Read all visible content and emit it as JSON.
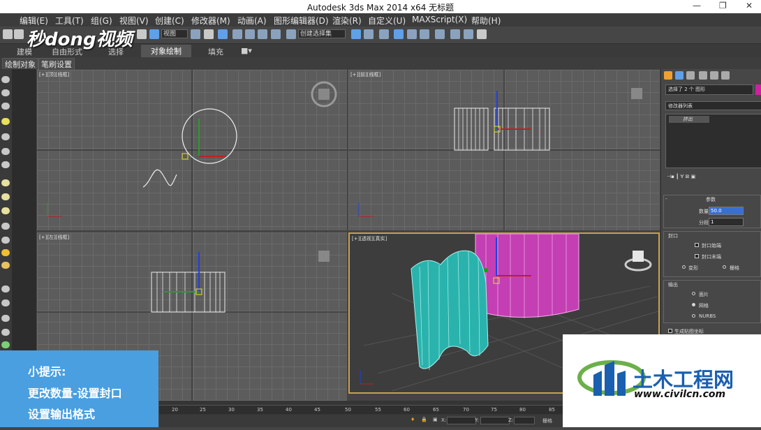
{
  "titlebar": {
    "title": "Autodesk 3ds Max  2014 x64     无标题",
    "controls": [
      "—",
      "❐",
      "✕"
    ]
  },
  "menu": {
    "items": [
      "编辑(E)",
      "工具(T)",
      "组(G)",
      "视图(V)",
      "创建(C)",
      "修改器(M)",
      "动画(A)",
      "图形编辑器(D)",
      "渲染(R)",
      "自定义(U)",
      "MAXScript(X)",
      "帮助(H)"
    ]
  },
  "toolbar": {
    "view_select": "视图",
    "named_sel": "创建选择集"
  },
  "ribbon": {
    "tabs": [
      "建模",
      "自由形式",
      "选择",
      "对象绘制",
      "填充"
    ],
    "active": "对象绘制",
    "subtabs": [
      "绘制对象",
      "笔刷设置"
    ]
  },
  "watermark": "秒dong视频",
  "viewports": {
    "top": "[+][顶][线框]",
    "front": "[+][前][线框]",
    "left": "[+][左][线框]",
    "perspective": "[+][透视][真实]"
  },
  "command_panel": {
    "selection_info": "选择了 2 个 图形",
    "modifier_list": "修改器列表",
    "stack_item": "挤出",
    "params_title": "参数",
    "amount_label": "数量:",
    "amount_value": "50.0",
    "segments_label": "分段:",
    "segments_value": "1",
    "capping_title": "封口",
    "cap_start": "封口始端",
    "cap_end": "封口末端",
    "morph": "变形",
    "grid": "栅格",
    "output_title": "输出",
    "patch": "面片",
    "mesh": "网格",
    "nurbs": "NURBS",
    "gen_map": "生成贴图坐标",
    "accent_color": "#d020a0"
  },
  "timeline": {
    "ticks": [
      "20",
      "25",
      "30",
      "35",
      "40",
      "45",
      "50",
      "55",
      "60",
      "65",
      "70",
      "75",
      "80",
      "85"
    ],
    "x_label": "X:",
    "y_label": "Y:",
    "z_label": "Z:",
    "grid_label": "栅格"
  },
  "tip": {
    "title": "小提示:",
    "line1": "更改数量-设置封口",
    "line2": "设置输出格式"
  },
  "logo": {
    "name": "土木工程网",
    "url": "www.civilcn.com"
  }
}
